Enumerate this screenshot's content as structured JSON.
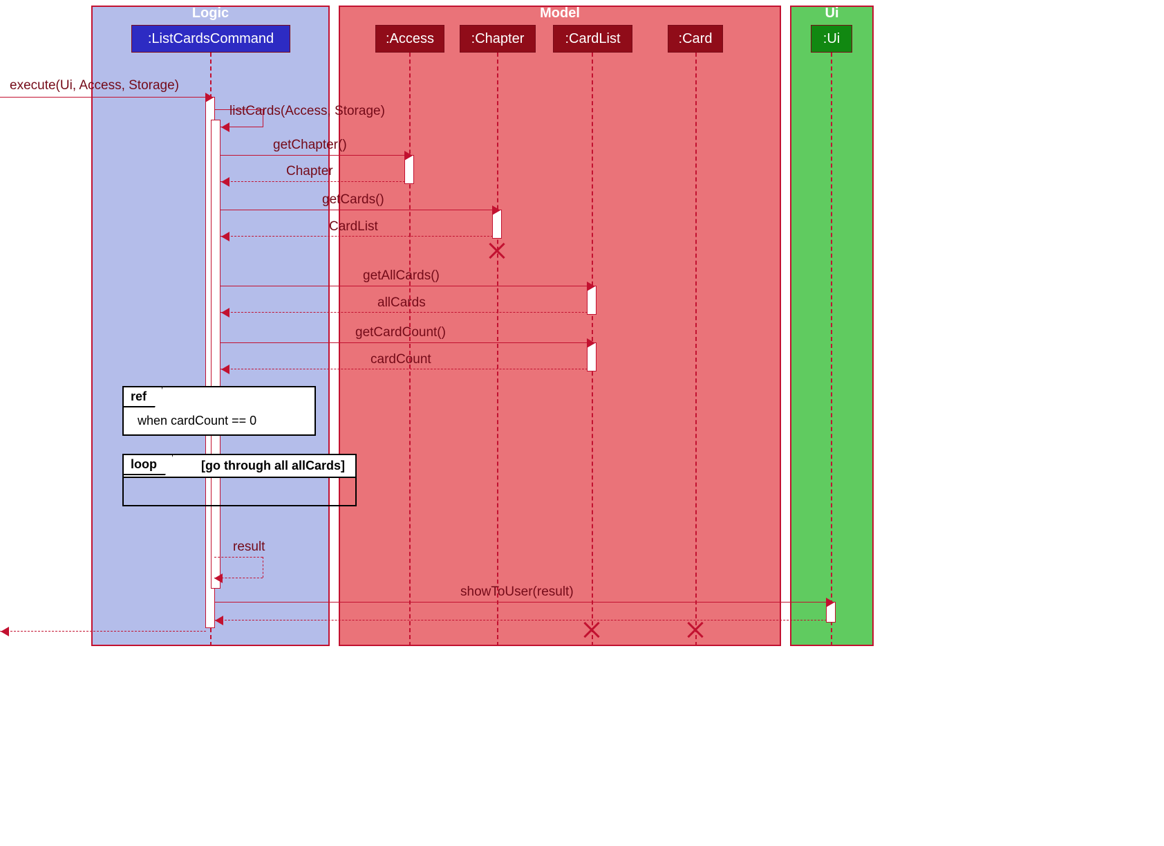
{
  "packages": {
    "logic": "Logic",
    "model": "Model",
    "ui": "Ui"
  },
  "participants": {
    "listcards": ":ListCardsCommand",
    "access": ":Access",
    "chapter": ":Chapter",
    "cardlist": ":CardList",
    "card": ":Card",
    "ui": ":Ui"
  },
  "messages": {
    "execute": "execute(Ui, Access, Storage)",
    "listcards_self": "listCards(Access, Storage)",
    "getchapter": "getChapter()",
    "chapter_ret": "Chapter",
    "getcards": "getCards()",
    "cardlist_ret": "CardList",
    "getallcards": "getAllCards()",
    "allcards_ret": "allCards",
    "getcardcount": "getCardCount()",
    "cardcount_ret": "cardCount",
    "result_ret": "result",
    "showtouser": "showToUser(result)"
  },
  "fragments": {
    "ref_label": "ref",
    "ref_text": "when cardCount == 0",
    "loop_label": "loop",
    "loop_guard": "[go through all allCards]"
  }
}
